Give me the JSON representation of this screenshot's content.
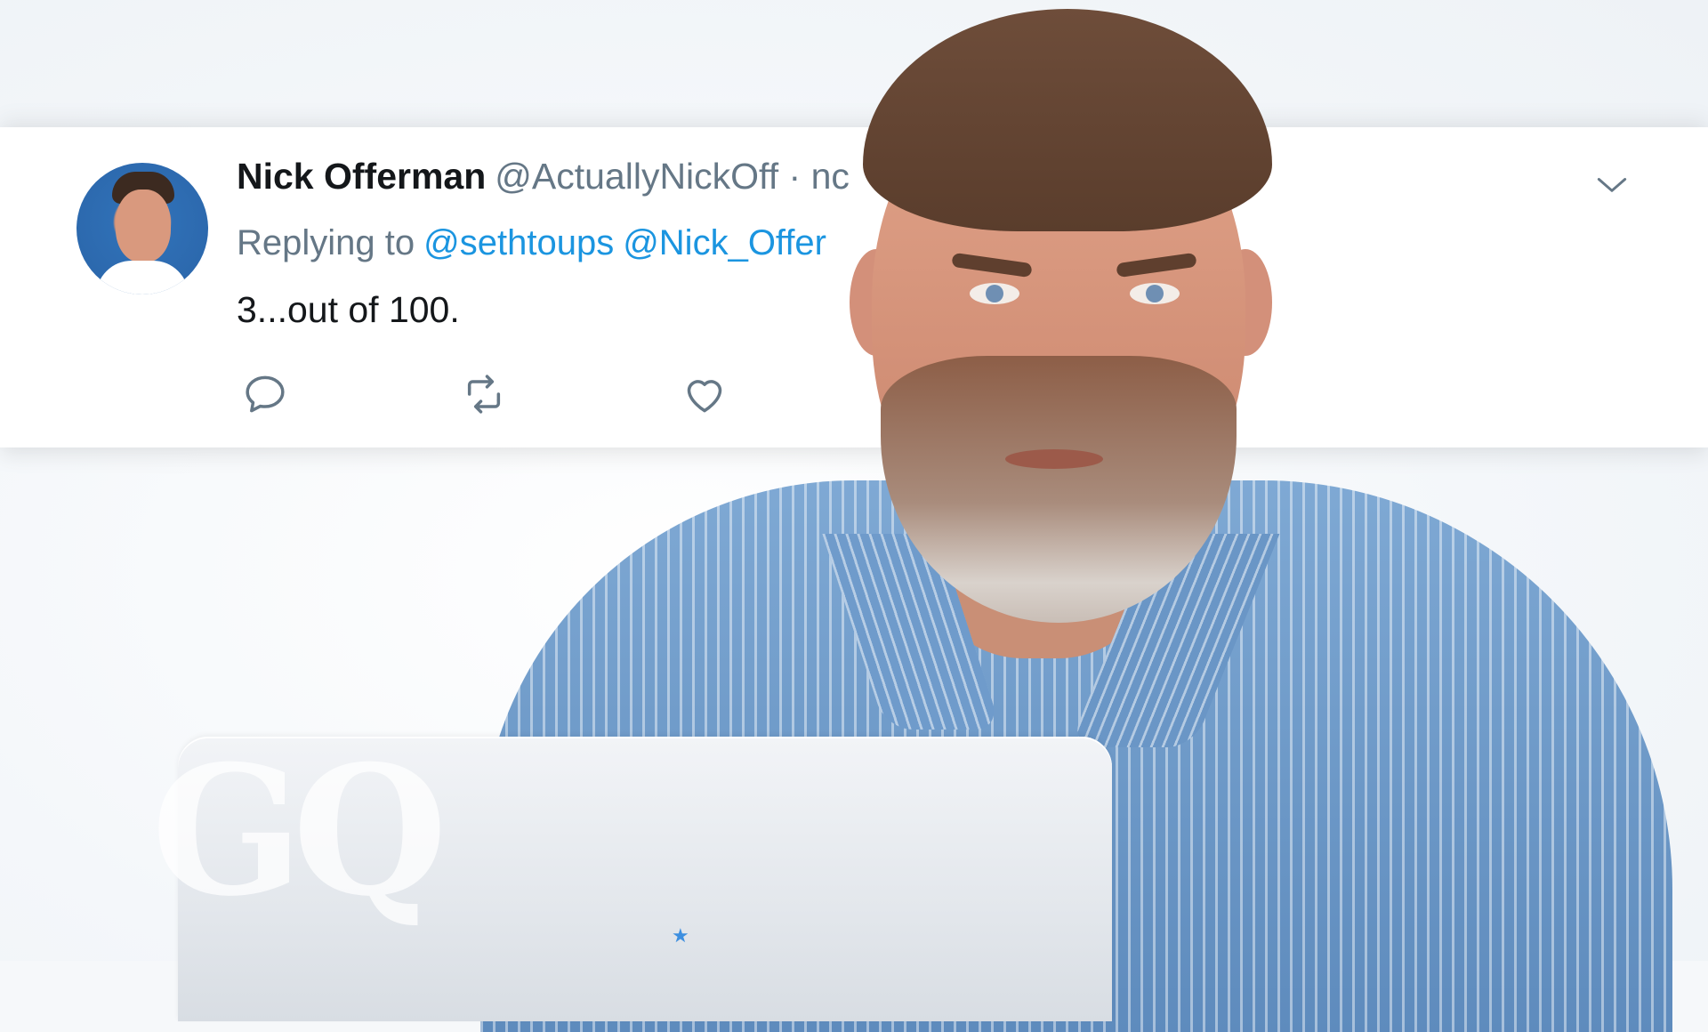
{
  "tweet": {
    "display_name": "Nick Offerman",
    "handle": "@ActuallyNickOff",
    "separator": "·",
    "time": "nc",
    "replying_label": "Replying to",
    "mentions": [
      "@sethtoups",
      "@Nick_Offer"
    ],
    "text": "3...out of 100."
  },
  "actions": {
    "reply_icon": "reply-icon",
    "retweet_icon": "retweet-icon",
    "like_icon": "heart-icon",
    "more_icon": "chevron-down-icon"
  },
  "watermark": "GQ",
  "colors": {
    "link": "#1b95e0",
    "secondary_text": "#657786",
    "primary_text": "#14171a",
    "shirt": "#7fa9d4",
    "laptop_star": "#3d8fe0"
  }
}
